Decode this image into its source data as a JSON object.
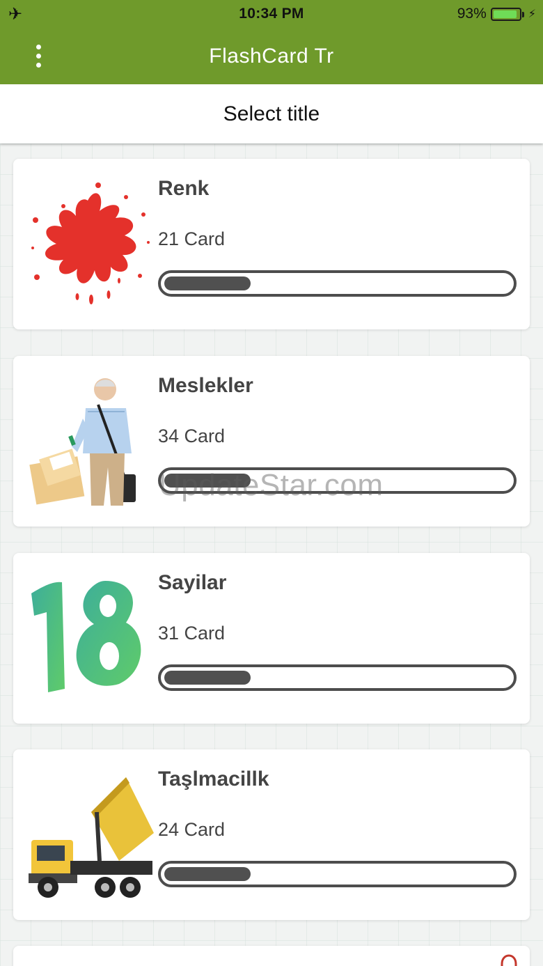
{
  "status_bar": {
    "time": "10:34 PM",
    "battery_percent": "93%",
    "battery_level": 0.93,
    "airplane_icon": "airplane-icon",
    "charging_icon": "bolt-icon"
  },
  "app_bar": {
    "title": "FlashCard Tr",
    "menu_icon": "more-vertical-icon"
  },
  "header": {
    "title": "Select title"
  },
  "cards": [
    {
      "title": "Renk",
      "count": "21 Card",
      "progress": 0.25,
      "image": "paint-splash"
    },
    {
      "title": "Meslekler",
      "count": "34 Card",
      "progress": 0.25,
      "image": "postman"
    },
    {
      "title": "Sayilar",
      "count": "31 Card",
      "progress": 0.25,
      "image": "number-18"
    },
    {
      "title": "Taşlmacillk",
      "count": "24 Card",
      "progress": 0.25,
      "image": "dump-truck"
    }
  ],
  "watermark": "UpdateStar.com",
  "colors": {
    "app_bar": "#6f9a2b",
    "progress_fill": "#505050",
    "progress_border": "#4d4d4d",
    "battery": "#6fdc57",
    "splash_red": "#e4312b"
  }
}
